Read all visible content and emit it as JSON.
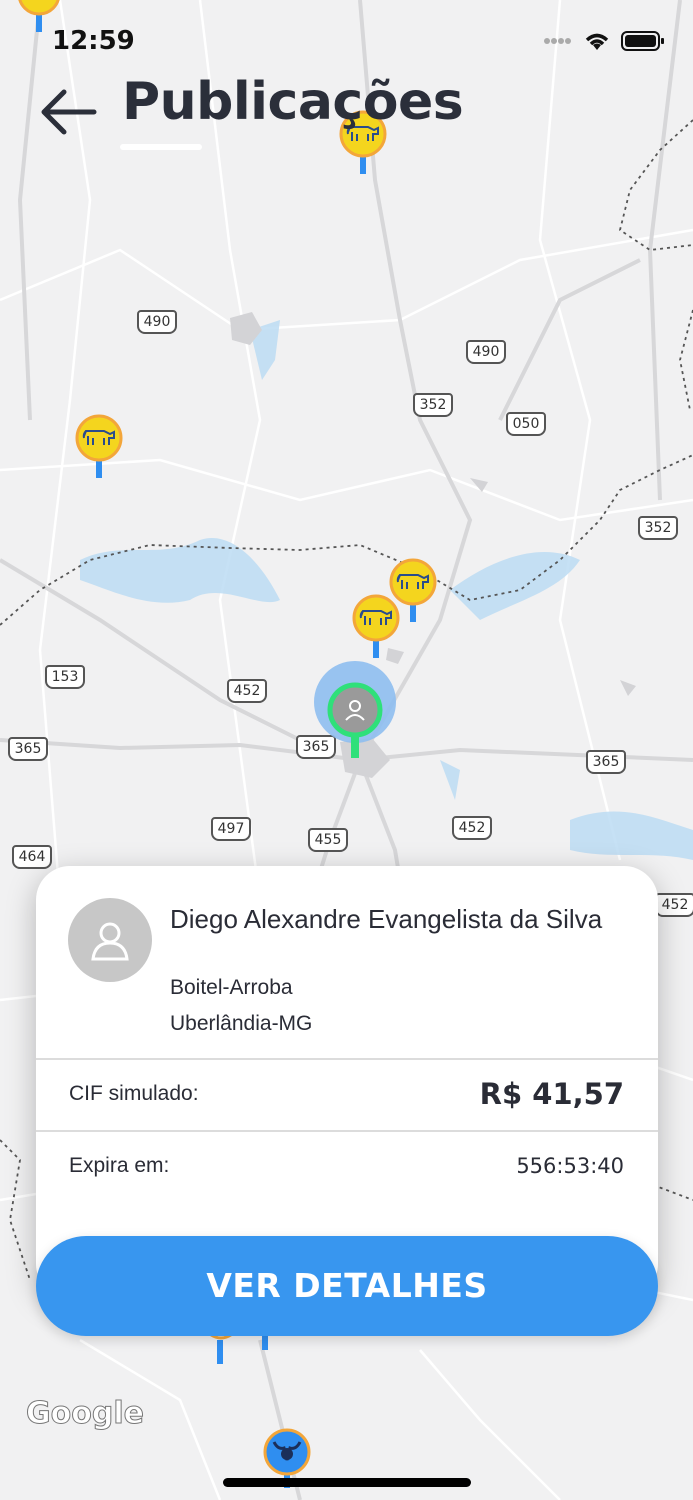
{
  "status_bar": {
    "time": "12:59"
  },
  "header": {
    "title": "Publicações"
  },
  "map": {
    "road_shields": [
      "490",
      "490",
      "352",
      "050",
      "352",
      "153",
      "452",
      "365",
      "365",
      "365",
      "497",
      "455",
      "452",
      "464",
      "452"
    ],
    "attribution": "Google"
  },
  "card": {
    "name": "Diego Alexandre Evangelista da Silva",
    "category": "Boitel-Arroba",
    "location": "Uberlândia-MG",
    "cif_label": "CIF simulado:",
    "cif_value": "R$ 41,57",
    "expires_label": "Expira em:",
    "expires_value": "556:53:40"
  },
  "cta": {
    "label": "VER DETALHES"
  },
  "colors": {
    "accent": "#3896ef",
    "pin_yellow": "#f4d51e",
    "pin_orange": "#f3a63a",
    "selected_green": "#2fe07a"
  }
}
